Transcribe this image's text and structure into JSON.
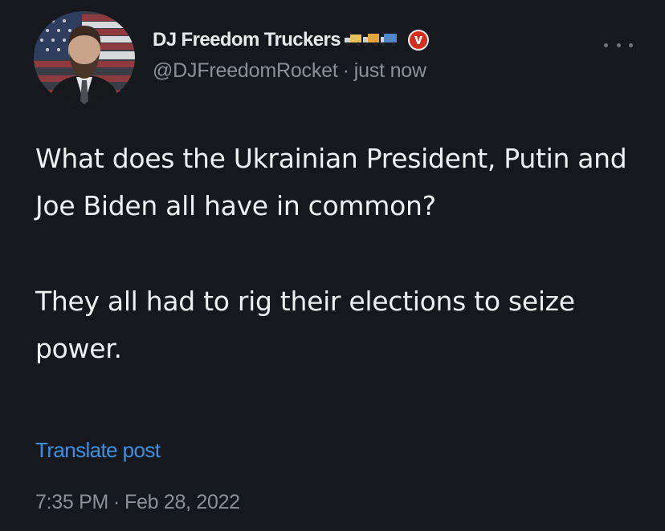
{
  "author": {
    "display_name": "DJ Freedom Truckers",
    "name_emojis": [
      "truck-icon",
      "truck-icon",
      "truck-icon"
    ],
    "handle": "@DJFreedomRocket",
    "separator": "·",
    "relative_time": "just now",
    "verified_badge_letter": "V"
  },
  "tweet": {
    "paragraphs": [
      "What does the Ukrainian President, Putin and Joe Biden all have in common?",
      "They all had to rig their elections to seize power."
    ]
  },
  "actions": {
    "translate_label": "Translate post"
  },
  "meta": {
    "time": "7:35 PM",
    "separator": "·",
    "date": "Feb 28, 2022"
  },
  "colors": {
    "background": "#15181d",
    "text": "#e7e9ea",
    "secondary_text": "#8b9196",
    "link": "#3d8fe0",
    "badge": "#d62d20"
  }
}
